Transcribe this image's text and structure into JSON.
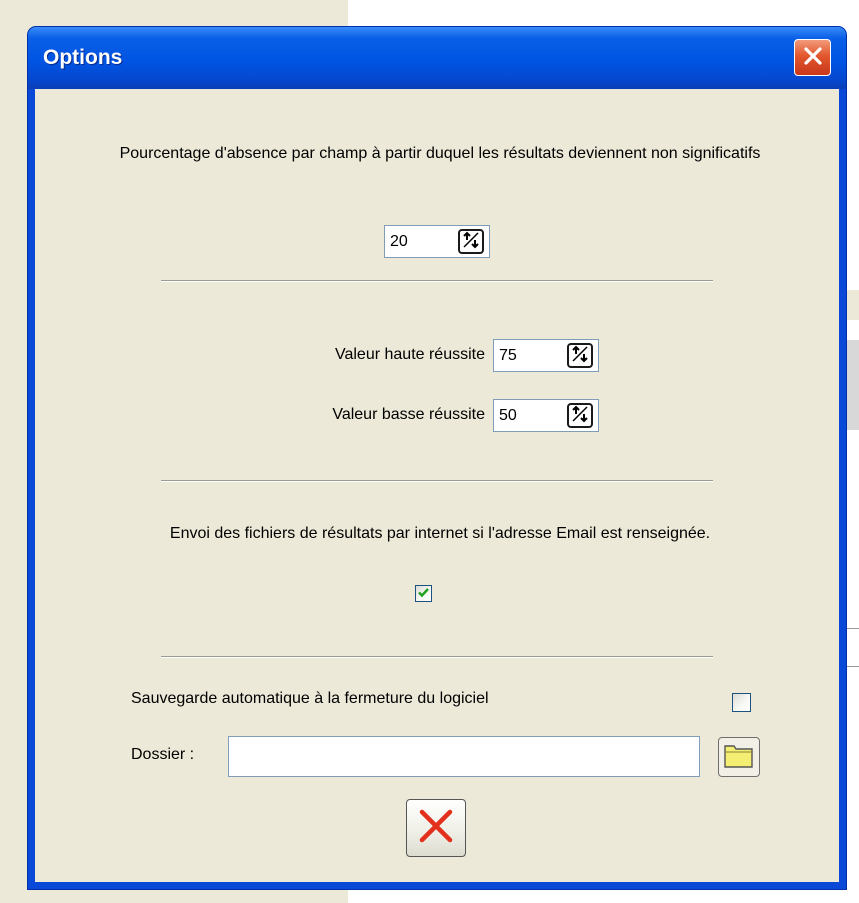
{
  "window": {
    "title": "Options",
    "colors": {
      "titlebar": "#0054e3",
      "client": "#ece9d8",
      "close": "#e2572e"
    }
  },
  "absence": {
    "label": "Pourcentage d'absence par champ à partir duquel les résultats deviennent non significatifs",
    "value": "20"
  },
  "reussite": {
    "haute_label": "Valeur haute réussite",
    "haute_value": "75",
    "basse_label": "Valeur basse réussite",
    "basse_value": "50"
  },
  "email": {
    "label": "Envoi des fichiers de résultats par internet si l'adresse Email est renseignée.",
    "checked": true
  },
  "sauvegarde": {
    "label": "Sauvegarde automatique à la fermeture du logiciel",
    "checked": false,
    "dossier_label": "Dossier :",
    "dossier_value": ""
  },
  "icons": {
    "close": "close-icon",
    "spin": "spin-arrows-icon",
    "check": "checkmark-icon",
    "folder": "folder-icon",
    "cancel": "cancel-x-icon"
  }
}
